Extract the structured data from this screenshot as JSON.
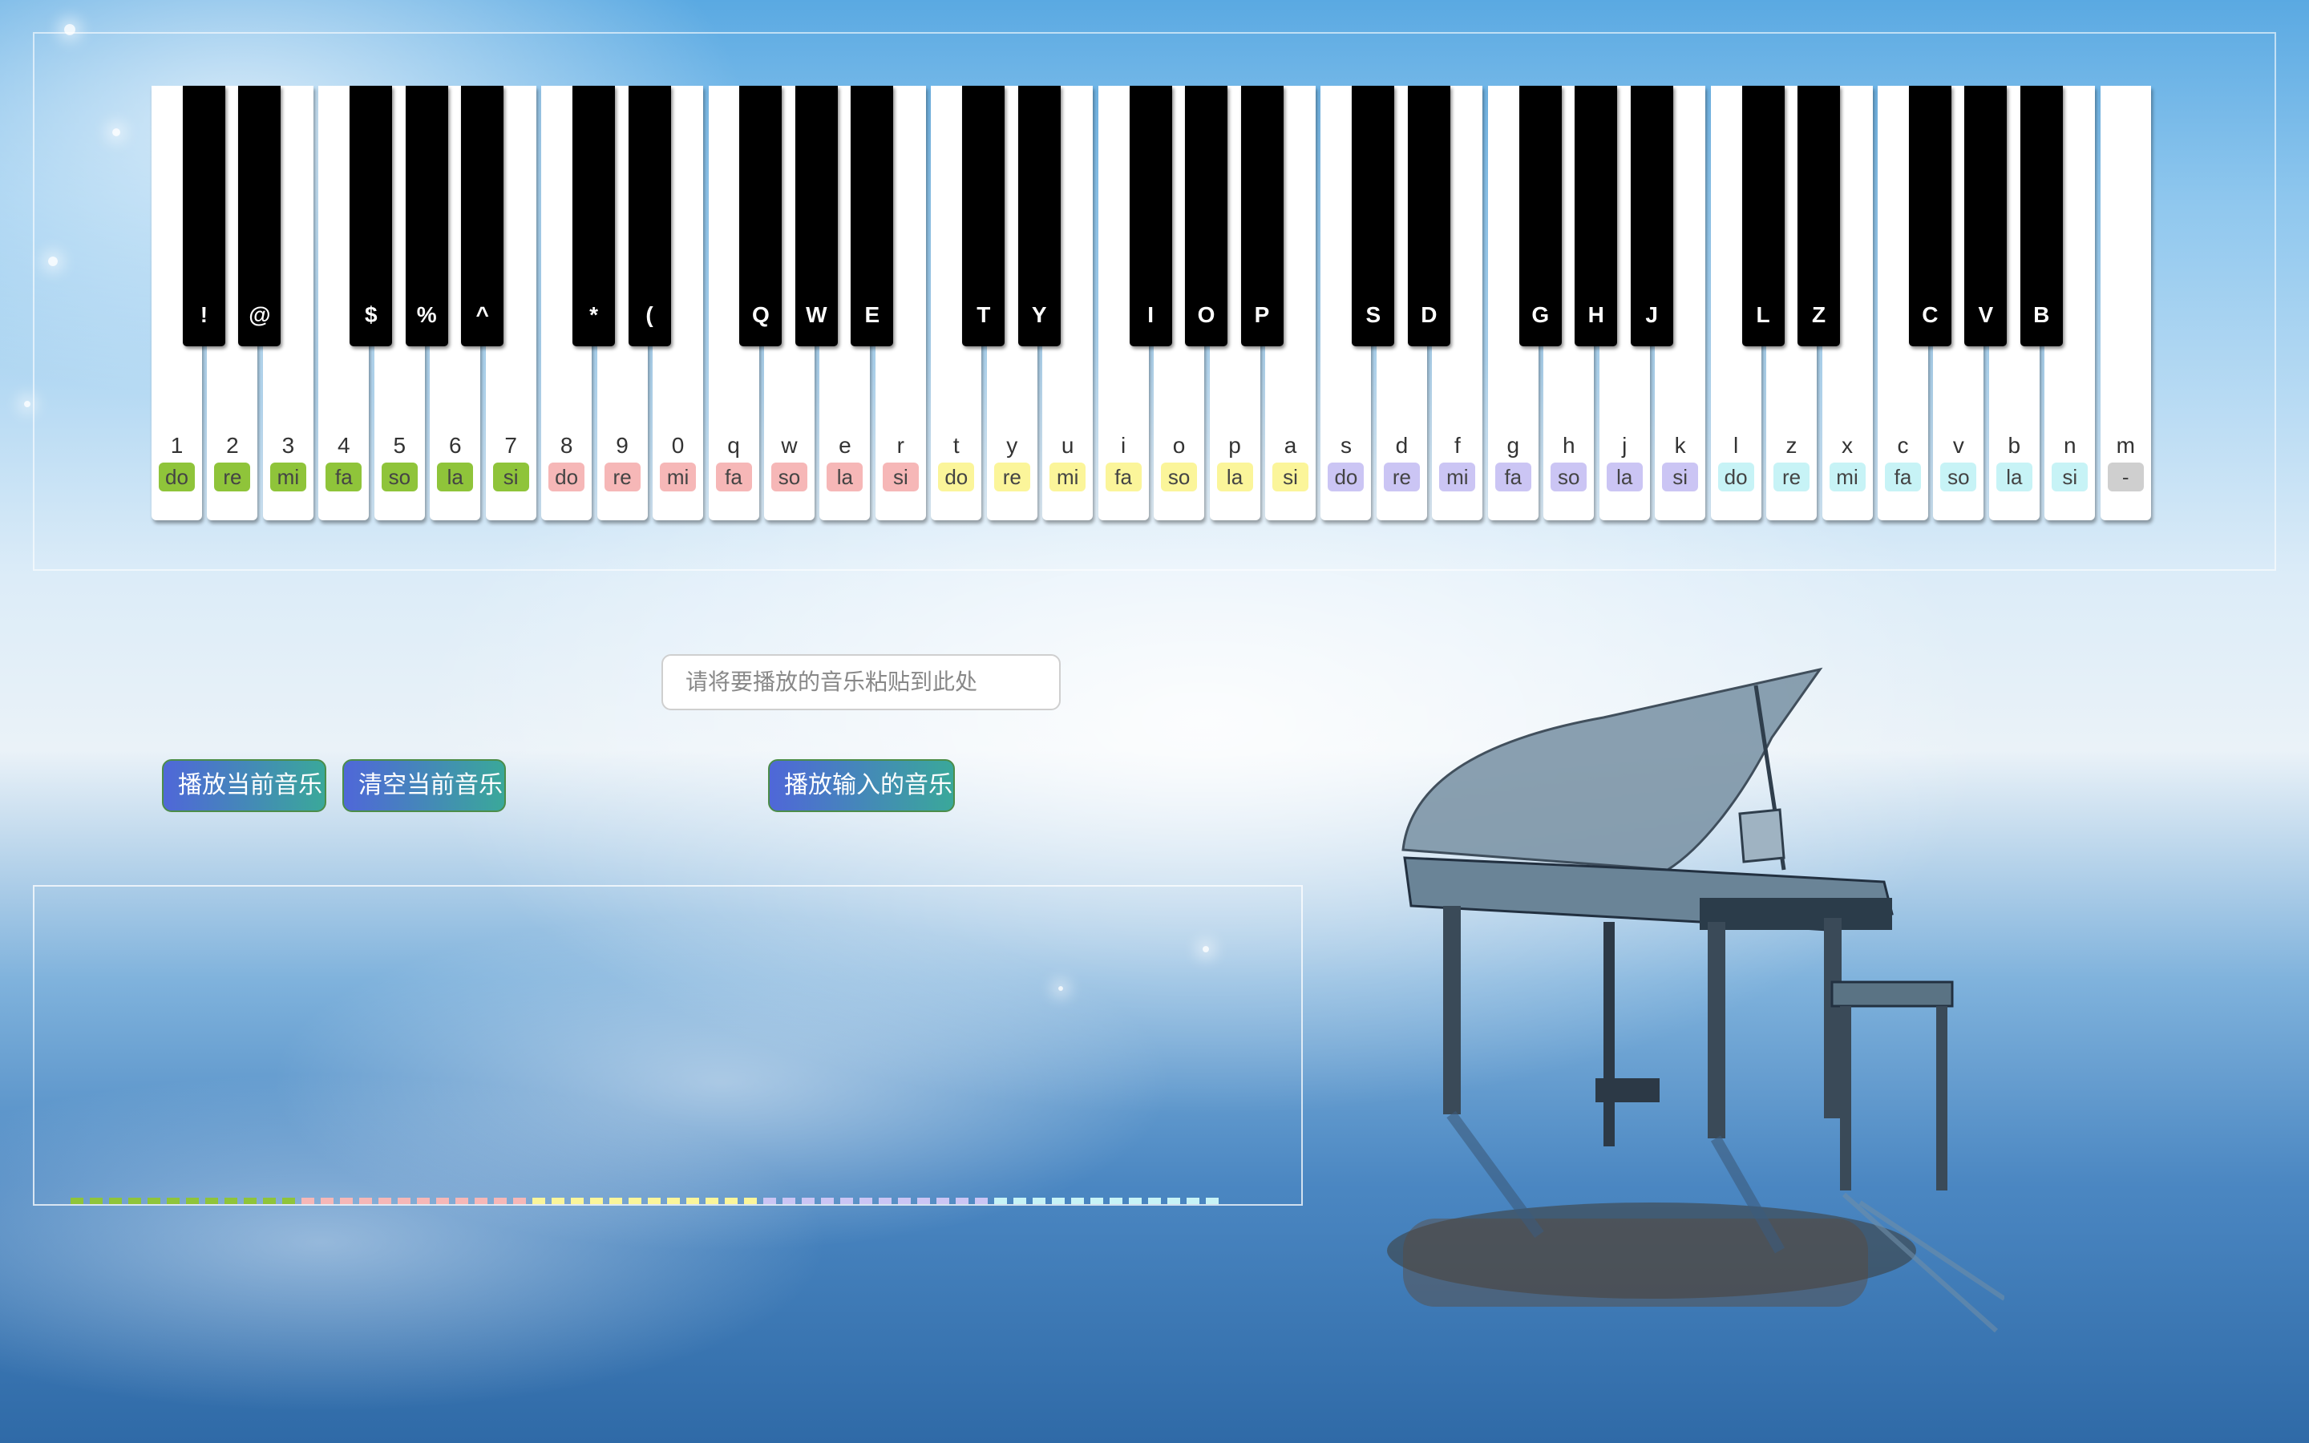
{
  "white_keys": [
    {
      "key": "1",
      "note": "do",
      "color": "#8fc43a"
    },
    {
      "key": "2",
      "note": "re",
      "color": "#8fc43a"
    },
    {
      "key": "3",
      "note": "mi",
      "color": "#8fc43a"
    },
    {
      "key": "4",
      "note": "fa",
      "color": "#8fc43a"
    },
    {
      "key": "5",
      "note": "so",
      "color": "#8fc43a"
    },
    {
      "key": "6",
      "note": "la",
      "color": "#8fc43a"
    },
    {
      "key": "7",
      "note": "si",
      "color": "#8fc43a"
    },
    {
      "key": "8",
      "note": "do",
      "color": "#f6b7b7"
    },
    {
      "key": "9",
      "note": "re",
      "color": "#f6b7b7"
    },
    {
      "key": "0",
      "note": "mi",
      "color": "#f6b7b7"
    },
    {
      "key": "q",
      "note": "fa",
      "color": "#f6b7b7"
    },
    {
      "key": "w",
      "note": "so",
      "color": "#f6b7b7"
    },
    {
      "key": "e",
      "note": "la",
      "color": "#f6b7b7"
    },
    {
      "key": "r",
      "note": "si",
      "color": "#f6b7b7"
    },
    {
      "key": "t",
      "note": "do",
      "color": "#fbf59a"
    },
    {
      "key": "y",
      "note": "re",
      "color": "#fbf59a"
    },
    {
      "key": "u",
      "note": "mi",
      "color": "#fbf59a"
    },
    {
      "key": "i",
      "note": "fa",
      "color": "#fbf59a"
    },
    {
      "key": "o",
      "note": "so",
      "color": "#fbf59a"
    },
    {
      "key": "p",
      "note": "la",
      "color": "#fbf59a"
    },
    {
      "key": "a",
      "note": "si",
      "color": "#fbf59a"
    },
    {
      "key": "s",
      "note": "do",
      "color": "#cbc5f4"
    },
    {
      "key": "d",
      "note": "re",
      "color": "#cbc5f4"
    },
    {
      "key": "f",
      "note": "mi",
      "color": "#cbc5f4"
    },
    {
      "key": "g",
      "note": "fa",
      "color": "#cbc5f4"
    },
    {
      "key": "h",
      "note": "so",
      "color": "#cbc5f4"
    },
    {
      "key": "j",
      "note": "la",
      "color": "#cbc5f4"
    },
    {
      "key": "k",
      "note": "si",
      "color": "#cbc5f4"
    },
    {
      "key": "l",
      "note": "do",
      "color": "#c7f3f6"
    },
    {
      "key": "z",
      "note": "re",
      "color": "#c7f3f6"
    },
    {
      "key": "x",
      "note": "mi",
      "color": "#c7f3f6"
    },
    {
      "key": "c",
      "note": "fa",
      "color": "#c7f3f6"
    },
    {
      "key": "v",
      "note": "so",
      "color": "#c7f3f6"
    },
    {
      "key": "b",
      "note": "la",
      "color": "#c7f3f6"
    },
    {
      "key": "n",
      "note": "si",
      "color": "#c7f3f6"
    },
    {
      "key": "m",
      "note": "-",
      "color": "#cfcfcf"
    }
  ],
  "black_keys": [
    "!",
    "@",
    "",
    "$",
    "%",
    "^",
    "",
    "*",
    "(",
    "",
    "Q",
    "W",
    "E",
    "",
    "T",
    "Y",
    "",
    "I",
    "O",
    "P",
    "",
    "S",
    "D",
    "",
    "G",
    "H",
    "J",
    "",
    "L",
    "Z",
    "",
    "C",
    "V",
    "B"
  ],
  "input": {
    "placeholder": "请将要播放的音乐粘贴到此处",
    "value": ""
  },
  "buttons": {
    "play_current": "播放当前音乐",
    "clear_current": "清空当前音乐",
    "play_input": "播放输入的音乐"
  },
  "output": {
    "dash_colors": [
      "#8fc43a",
      "#f6b7b7",
      "#fbf59a",
      "#cbc5f4",
      "#c7f3f6"
    ]
  }
}
